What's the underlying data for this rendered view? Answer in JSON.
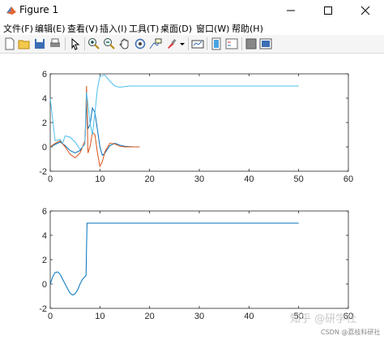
{
  "window": {
    "title": "Figure 1"
  },
  "menu": [
    "文件(F)",
    "编辑(E)",
    "查看(V)",
    "插入(I)",
    "工具(T)",
    "桌面(D)",
    "窗口(W)",
    "帮助(H)"
  ],
  "toolbar": [
    "new-figure-icon",
    "open-file-icon",
    "save-icon",
    "print-icon",
    "pointer-icon",
    "zoom-in-icon",
    "zoom-out-icon",
    "pan-hand-icon",
    "rotate-3d-icon",
    "data-cursor-icon",
    "brush-icon",
    "brush-dropdown-icon",
    "link-plot-icon",
    "insert-colorbar-icon",
    "insert-legend-icon",
    "hide-plot-tools-icon",
    "show-plot-tools-icon"
  ],
  "watermark": {
    "main": "知乎 @研学社",
    "sub": "CSDN @荔枝科研社"
  },
  "colors": {
    "c1": "#0072BD",
    "c2": "#D95319",
    "c3": "#4DBEEE"
  },
  "chart_data": [
    {
      "type": "line",
      "xlim": [
        0,
        60
      ],
      "ylim": [
        -2,
        6
      ],
      "xticks": [
        "0",
        "10",
        "20",
        "30",
        "40",
        "50",
        "60"
      ],
      "yticks": [
        "-2",
        "0",
        "2",
        "4",
        "6"
      ],
      "series": [
        {
          "color": "#0072BD",
          "x": [
            0,
            1,
            2,
            3,
            4,
            5,
            6,
            6.5,
            7,
            7.3,
            7.6,
            8,
            8.5,
            9,
            9.5,
            10,
            10.5,
            11,
            12,
            13,
            14,
            15,
            16,
            17,
            18
          ],
          "y": [
            0,
            0.2,
            0.4,
            0.1,
            -0.3,
            -0.5,
            -0.3,
            0,
            0.5,
            3.5,
            1.5,
            1.8,
            3.2,
            2.8,
            1.4,
            0,
            -0.7,
            -0.5,
            0.1,
            0.3,
            0.15,
            0.05,
            0.02,
            0,
            0
          ]
        },
        {
          "color": "#D95319",
          "x": [
            0,
            1,
            2,
            3,
            4,
            5,
            6,
            6.5,
            7,
            7.3,
            7.6,
            8,
            8.5,
            9,
            9.5,
            10,
            10.5,
            11,
            12,
            13,
            14,
            15,
            16,
            17,
            18
          ],
          "y": [
            0,
            0.3,
            0.5,
            0,
            -0.6,
            -0.9,
            -0.5,
            0,
            0.5,
            5.0,
            -0.5,
            0,
            1.2,
            1.0,
            -0.5,
            -1.6,
            -1.2,
            -0.4,
            0.3,
            0.25,
            0.05,
            0,
            0,
            0,
            0
          ]
        },
        {
          "color": "#4DBEEE",
          "x": [
            0,
            1,
            2,
            2.5,
            3,
            4,
            5,
            6,
            7,
            7.3,
            8,
            8.5,
            9,
            9.5,
            10,
            11,
            12,
            13,
            14,
            15,
            16,
            18,
            20,
            25,
            30,
            40,
            50
          ],
          "y": [
            4,
            0.5,
            0.6,
            0.3,
            0.9,
            0.8,
            0.4,
            -0.2,
            0.2,
            4.5,
            2.0,
            1.0,
            2.8,
            4.8,
            5.8,
            5.9,
            5.4,
            5.0,
            4.9,
            4.95,
            5.0,
            5.0,
            5.0,
            5.0,
            5.0,
            5.0,
            5.0
          ]
        }
      ]
    },
    {
      "type": "line",
      "xlim": [
        0,
        60
      ],
      "ylim": [
        -2,
        6
      ],
      "xticks": [
        "0",
        "10",
        "20",
        "30",
        "40",
        "50",
        "60"
      ],
      "yticks": [
        "-2",
        "0",
        "2",
        "4",
        "6"
      ],
      "series": [
        {
          "color": "#0072BD",
          "x": [
            0,
            0.5,
            1,
            1.5,
            2,
            2.5,
            3,
            3.5,
            4,
            4.5,
            5,
            5.5,
            6,
            6.5,
            7,
            7.2,
            7.4,
            10,
            20,
            30,
            40,
            50
          ],
          "y": [
            0,
            0.6,
            0.95,
            1.0,
            0.8,
            0.4,
            0,
            -0.4,
            -0.75,
            -0.9,
            -0.8,
            -0.5,
            0,
            0.4,
            0.6,
            0.7,
            5.0,
            5.0,
            5.0,
            5.0,
            5.0,
            5.0
          ]
        }
      ]
    }
  ]
}
